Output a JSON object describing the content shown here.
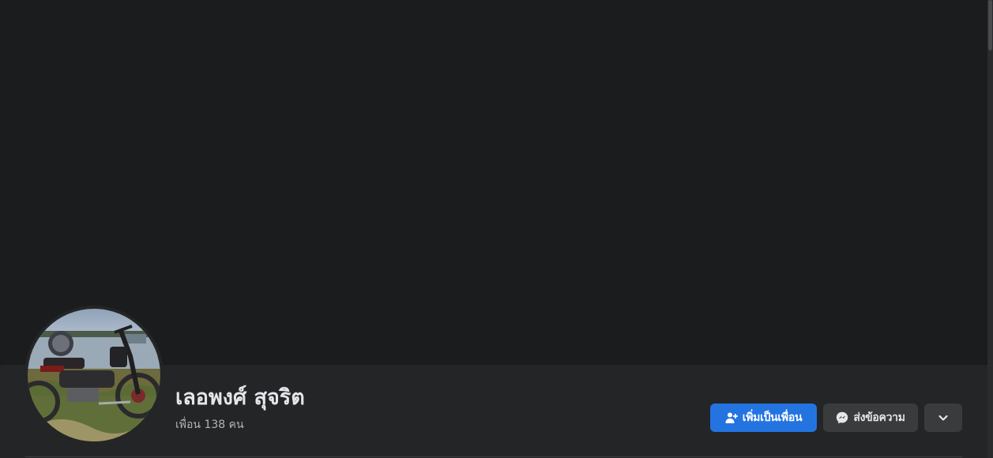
{
  "profile": {
    "name": "เลอพงศ์ สุจริต",
    "friends_count_text": "เพื่อน 138 คน"
  },
  "actions": {
    "add_friend_label": "เพิ่มเป็นเพื่อน",
    "message_label": "ส่งข้อความ",
    "more_icon": "chevron-down-icon"
  },
  "colors": {
    "primary_button": "#2374e1",
    "secondary_button": "#3a3b3c",
    "background": "#18191a",
    "surface": "#242526"
  }
}
